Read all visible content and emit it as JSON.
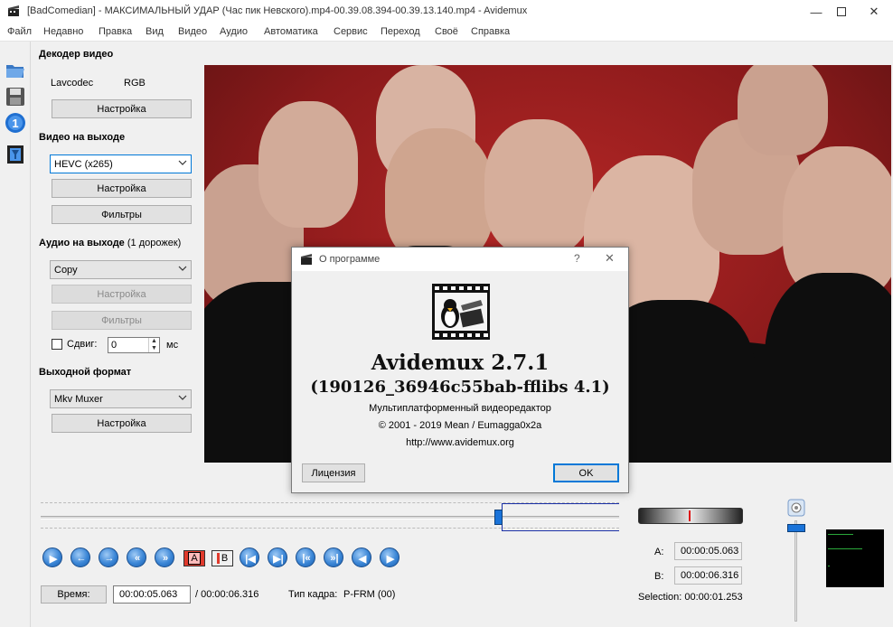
{
  "window": {
    "title": "[BadComedian] - МАКСИМАЛЬНЫЙ УДАР (Час пик Невского).mp4-00.39.08.394-00.39.13.140.mp4 - Avidemux"
  },
  "menu": [
    "Файл",
    "Недавно",
    "Правка",
    "Вид",
    "Видео",
    "Аудио",
    "Автоматика",
    "Сервис",
    "Переход",
    "Своё",
    "Справка"
  ],
  "toolbar_icons": [
    "open-folder-icon",
    "save-disk-icon",
    "info-icon",
    "filter-film-icon"
  ],
  "left_panel": {
    "video_decoder": {
      "title": "Декодер видео",
      "codec": "Lavcodec",
      "format": "RGB",
      "config_label": "Настройка"
    },
    "video_output": {
      "title": "Видео на выходе",
      "selected": "HEVC (x265)",
      "config_label": "Настройка",
      "filters_label": "Фильтры"
    },
    "audio_output": {
      "title": "Аудио на выходе",
      "tracks": "(1 дорожек)",
      "selected": "Copy",
      "config_label": "Настройка",
      "filters_label": "Фильтры",
      "shift_label": "Сдвиг:",
      "shift_value": "0",
      "shift_unit": "мс",
      "shift_checked": false
    },
    "output_format": {
      "title": "Выходной формат",
      "selected": "Mkv Muxer",
      "config_label": "Настройка"
    }
  },
  "about_dialog": {
    "title": "О программе",
    "help": "?",
    "app_name": "Avidemux 2.7.1",
    "build": "(190126_36946c55bab-fflibs 4.1)",
    "description": "Мультиплатформенный видеоредактор",
    "copyright": "© 2001 - 2019  Mean / Eumagga0x2a",
    "url": "http://www.avidemux.org",
    "license_label": "Лицензия",
    "ok_label": "OK"
  },
  "playback": {
    "seek_position": 0.79,
    "marker_a_label": "A",
    "marker_b_label": "B",
    "time_button": "Время:",
    "current_time": "00:00:05.063",
    "total_time": "/ 00:00:06.316",
    "frame_type_label": "Тип кадра:",
    "frame_type": "P-FRM (00)",
    "a_label": "A:",
    "a_value": "00:00:05.063",
    "b_label": "B:",
    "b_value": "00:00:06.316",
    "selection": "Selection: 00:00:01.253"
  },
  "colors": {
    "accent": "#0078d7",
    "video_bg": "#a32222",
    "timeline_selection": "#1a2fa6"
  }
}
